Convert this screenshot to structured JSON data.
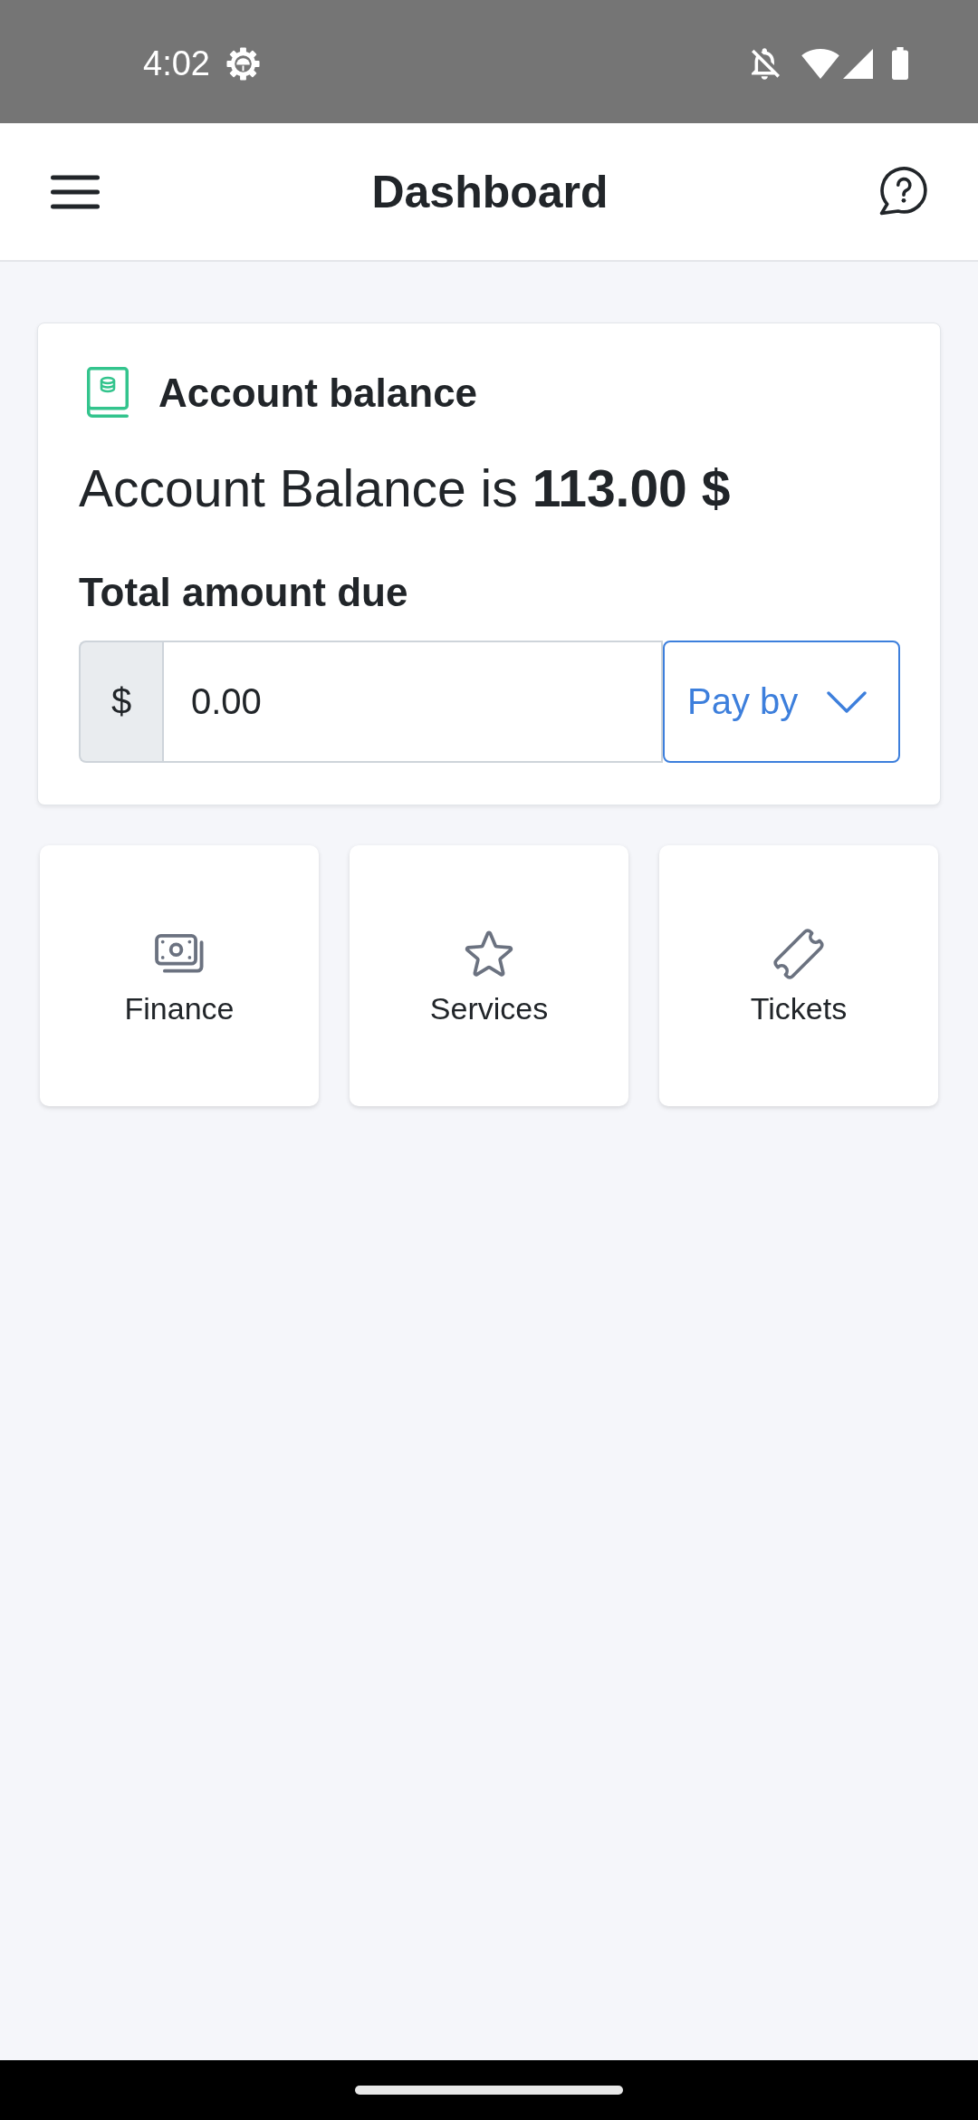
{
  "status_bar": {
    "time": "4:02"
  },
  "app_bar": {
    "title": "Dashboard"
  },
  "balance_card": {
    "title": "Account balance",
    "balance_text": "Account Balance is **113.00 $**",
    "amount_label": "Total amount due",
    "amount_field": {
      "prefix": "$",
      "value": "0.00"
    },
    "pay_button": {
      "label": "Pay by"
    }
  },
  "tiles": [
    {
      "label": "Finance"
    },
    {
      "label": "Services"
    },
    {
      "label": "Tickets"
    }
  ]
}
